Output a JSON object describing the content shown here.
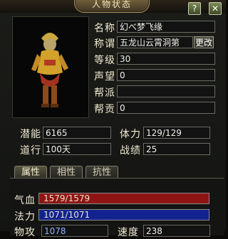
{
  "window": {
    "title": "人物状态",
    "help_icon": "question-icon",
    "close_icon": "close-icon"
  },
  "character": {
    "name_label": "名称",
    "name_value": "幻べ梦飞缘",
    "title_label": "称谓",
    "title_value": "五龙山云霄洞第",
    "change_button": "更改",
    "level_label": "等级",
    "level_value": "30",
    "prestige_label": "声望",
    "prestige_value": "0",
    "faction_label": "帮派",
    "faction_value": "",
    "contribution_label": "帮贡",
    "contribution_value": "0"
  },
  "stats": {
    "potential_label": "潜能",
    "potential_value": "6165",
    "stamina_label": "体力",
    "stamina_value": "129/129",
    "dao_label": "道行",
    "dao_value": "100天",
    "battle_label": "战绩",
    "battle_value": "25"
  },
  "tabs": [
    {
      "label": "属性",
      "active": true
    },
    {
      "label": "相性",
      "active": false
    },
    {
      "label": "抗性",
      "active": false
    }
  ],
  "attributes": {
    "hp_label": "气血",
    "hp_value": "1579/1579",
    "hp_fraction": 1.0,
    "hp_color": "#8f1515",
    "mp_label": "法力",
    "mp_value": "1071/1071",
    "mp_fraction": 1.0,
    "mp_color": "#12238f",
    "attack_label": "物攻",
    "attack_value": "1078",
    "speed_label": "速度",
    "speed_value": "238"
  }
}
